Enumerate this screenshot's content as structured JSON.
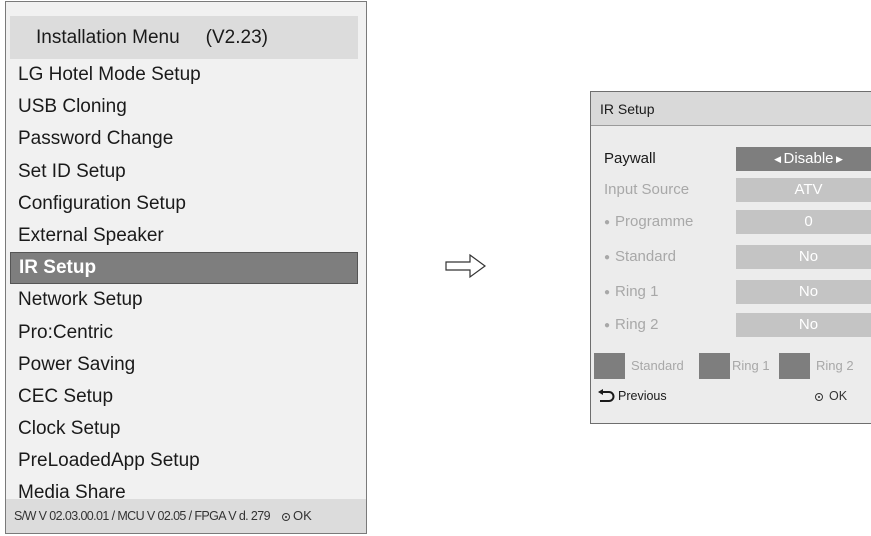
{
  "installation_menu": {
    "title": "Installation Menu",
    "version": "(V2.23)",
    "items": [
      {
        "label": "LG Hotel Mode Setup"
      },
      {
        "label": "USB Cloning"
      },
      {
        "label": "Password Change"
      },
      {
        "label": "Set ID Setup"
      },
      {
        "label": "Configuration Setup"
      },
      {
        "label": "External Speaker"
      },
      {
        "label": "IR Setup",
        "selected": true
      },
      {
        "label": "Network Setup"
      },
      {
        "label": "Pro:Centric"
      },
      {
        "label": "Power Saving"
      },
      {
        "label": "CEC Setup"
      },
      {
        "label": "Clock Setup"
      },
      {
        "label": "PreLoadedApp Setup"
      },
      {
        "label": "Media Share"
      }
    ],
    "footer_version": "S/W V 02.03.00.01 / MCU V 02.05 / FPGA V d. 279",
    "footer_ok": "OK"
  },
  "ir_setup": {
    "title": "IR Setup",
    "rows": [
      {
        "label": "Paywall",
        "value": "Disable",
        "active": true,
        "bullet": false
      },
      {
        "label": "Input Source",
        "value": "ATV",
        "active": false,
        "bullet": false
      },
      {
        "label": "Programme",
        "value": "0",
        "active": false,
        "bullet": true
      },
      {
        "label": "Standard",
        "value": "No",
        "active": false,
        "bullet": true
      },
      {
        "label": "Ring 1",
        "value": "No",
        "active": false,
        "bullet": true
      },
      {
        "label": "Ring 2",
        "value": "No",
        "active": false,
        "bullet": true
      }
    ],
    "legend": {
      "standard": "Standard",
      "ring1": "Ring 1",
      "ring2": "Ring 2"
    },
    "nav": {
      "previous": "Previous",
      "ok": "OK"
    },
    "icons": {
      "previous": "return-arrow-icon",
      "ok": "ok-dot-icon",
      "arrow": "right-arrow-icon"
    }
  },
  "colors": {
    "selected_bg": "#7e7e7e",
    "panel_bg": "#ececec",
    "disabled_value_bg": "#c4c4c4",
    "disabled_text": "#a8a8a8"
  }
}
